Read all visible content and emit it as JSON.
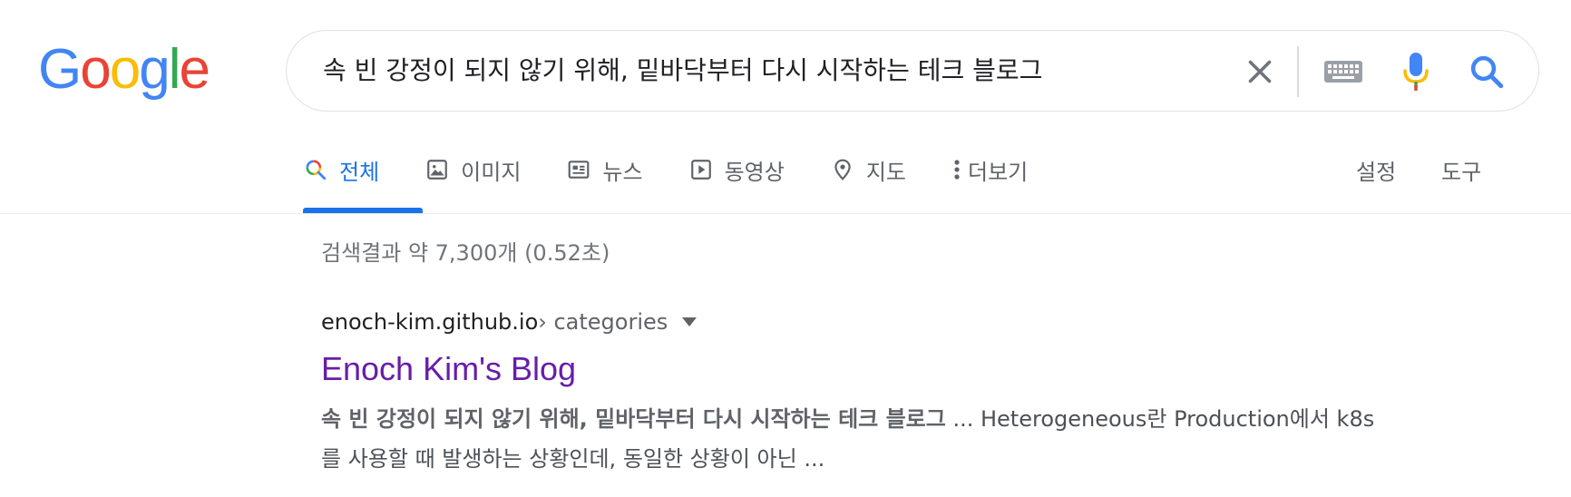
{
  "logo": {
    "letters": [
      "G",
      "o",
      "o",
      "g",
      "l",
      "e"
    ],
    "colors": [
      "#4285F4",
      "#EA4335",
      "#FBBC05",
      "#4285F4",
      "#34A853",
      "#EA4335"
    ]
  },
  "search": {
    "query": "속 빈 강정이 되지 않기 위해, 밑바닥부터 다시 시작하는 테크 블로그"
  },
  "tabs": [
    {
      "label": "전체",
      "icon": "search-multicolor-icon",
      "active": true
    },
    {
      "label": "이미지",
      "icon": "image-icon"
    },
    {
      "label": "뉴스",
      "icon": "news-icon"
    },
    {
      "label": "동영상",
      "icon": "video-icon"
    },
    {
      "label": "지도",
      "icon": "map-pin-icon"
    },
    {
      "label": "더보기",
      "icon": "more-vert-icon"
    }
  ],
  "settings_label": "설정",
  "tools_label": "도구",
  "result_stats": "검색결과 약 7,300개 (0.52초)",
  "result": {
    "domain": "enoch-kim.github.io",
    "path": " › categories",
    "title": "Enoch Kim's Blog",
    "snippet_bold": "속 빈 강정이 되지 않기 위해, 밑바닥부터 다시 시작하는 테크 블로그",
    "snippet_rest": " ... Heterogeneous란 Production에서 k8s를 사용할 때 발생하는 상황인데, 동일한 상황이 아닌 ..."
  },
  "colors": {
    "accent": "#1a73e8",
    "visited_link": "#681da8",
    "muted": "#5f6368"
  }
}
